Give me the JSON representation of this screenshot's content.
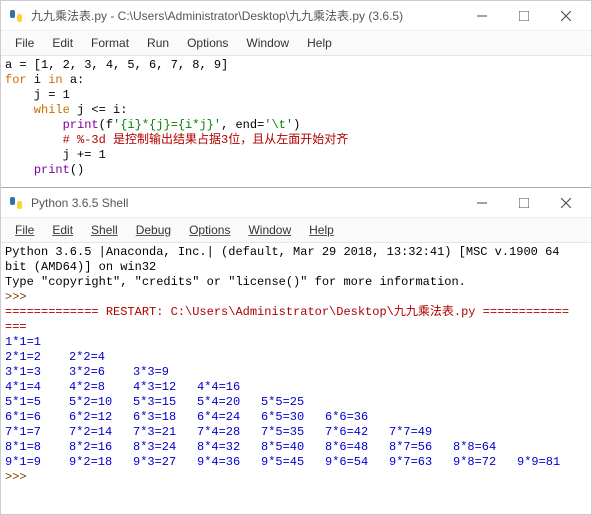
{
  "editor": {
    "title": "九九乘法表.py - C:\\Users\\Administrator\\Desktop\\九九乘法表.py (3.6.5)",
    "menus": [
      "File",
      "Edit",
      "Format",
      "Run",
      "Options",
      "Window",
      "Help"
    ],
    "code": {
      "l1_a": "a = [",
      "l1_nums": "1, 2, 3, 4, 5, 6, 7, 8, 9",
      "l1_b": "]",
      "l2_for": "for",
      "l2_rest": " i ",
      "l2_in": "in",
      "l2_end": " a:",
      "l3": "    j = ",
      "l3_num": "1",
      "l4_while": "    while",
      "l4_rest": " j <= i:",
      "l5_pre": "        ",
      "l5_print": "print",
      "l5_a": "(f",
      "l5_str": "'{i}*{j}={i*j}'",
      "l5_b": ", end=",
      "l5_str2": "'\\t'",
      "l5_c": ")",
      "l6": "        # %-3d 是控制输出结果占据3位，且从左面开始对齐",
      "l7": "        j += ",
      "l7_num": "1",
      "l8_pre": "    ",
      "l8_print": "print",
      "l8_b": "()"
    }
  },
  "shell": {
    "title": "Python 3.6.5 Shell",
    "menus": [
      "File",
      "Edit",
      "Shell",
      "Debug",
      "Options",
      "Window",
      "Help"
    ],
    "banner_l1": "Python 3.6.5 |Anaconda, Inc.| (default, Mar 29 2018, 13:32:41) [MSC v.1900 64 bit (AMD64)] on win32",
    "banner_l2": "Type \"copyright\", \"credits\" or \"license()\" for more information.",
    "prompt": ">>>",
    "restart_line": "============= RESTART: C:\\Users\\Administrator\\Desktop\\九九乘法表.py ============",
    "sep": "===",
    "table": [
      [
        "1*1=1"
      ],
      [
        "2*1=2",
        "2*2=4"
      ],
      [
        "3*1=3",
        "3*2=6",
        "3*3=9"
      ],
      [
        "4*1=4",
        "4*2=8",
        "4*3=12",
        "4*4=16"
      ],
      [
        "5*1=5",
        "5*2=10",
        "5*3=15",
        "5*4=20",
        "5*5=25"
      ],
      [
        "6*1=6",
        "6*2=12",
        "6*3=18",
        "6*4=24",
        "6*5=30",
        "6*6=36"
      ],
      [
        "7*1=7",
        "7*2=14",
        "7*3=21",
        "7*4=28",
        "7*5=35",
        "7*6=42",
        "7*7=49"
      ],
      [
        "8*1=8",
        "8*2=16",
        "8*3=24",
        "8*4=32",
        "8*5=40",
        "8*6=48",
        "8*7=56",
        "8*8=64"
      ],
      [
        "9*1=9",
        "9*2=18",
        "9*3=27",
        "9*4=36",
        "9*5=45",
        "9*6=54",
        "9*7=63",
        "9*8=72",
        "9*9=81"
      ]
    ],
    "prompt2": ">>>"
  },
  "chart_data": {
    "type": "table",
    "title": "九九乘法表 (9×9 multiplication table)",
    "rows": [
      [
        1
      ],
      [
        2,
        4
      ],
      [
        3,
        6,
        9
      ],
      [
        4,
        8,
        12,
        16
      ],
      [
        5,
        10,
        15,
        20,
        25
      ],
      [
        6,
        12,
        18,
        24,
        30,
        36
      ],
      [
        7,
        14,
        21,
        28,
        35,
        42,
        49
      ],
      [
        8,
        16,
        24,
        32,
        40,
        48,
        56,
        64
      ],
      [
        9,
        18,
        27,
        36,
        45,
        54,
        63,
        72,
        81
      ]
    ]
  }
}
